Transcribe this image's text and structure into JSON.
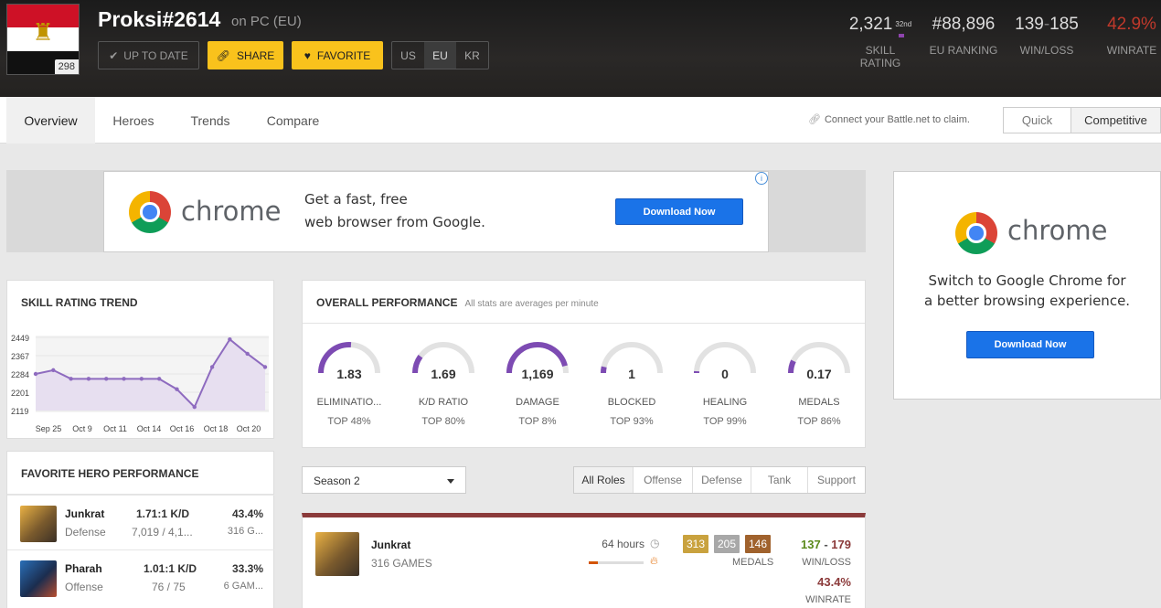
{
  "header": {
    "player_name": "Proksi#2614",
    "platform": "on PC (EU)",
    "level": "298",
    "up_to_date_label": "UP TO DATE",
    "share_label": "SHARE",
    "favorite_label": "FAVORITE",
    "regions": [
      "US",
      "EU",
      "KR"
    ],
    "active_region": "EU",
    "stats": {
      "skill_rating": "2,321",
      "skill_rating_sub": "32nd",
      "skill_rating_label": "SKILL RATING",
      "eu_ranking": "#88,896",
      "eu_ranking_label": "EU RANKING",
      "wins": "139",
      "losses": "185",
      "winloss_label": "WIN/LOSS",
      "winrate": "42.9%",
      "winrate_label": "WINRATE"
    }
  },
  "nav": {
    "tabs": [
      "Overview",
      "Heroes",
      "Trends",
      "Compare"
    ],
    "active_tab": "Overview",
    "claim_text": "Connect your Battle.net to claim.",
    "modes": [
      "Quick",
      "Competitive"
    ],
    "active_mode": "Competitive"
  },
  "ad_main": {
    "brand": "chrome",
    "line1": "Get a fast, free",
    "line2": "web browser from Google.",
    "button": "Download Now"
  },
  "ad_side": {
    "brand": "chrome",
    "line1": "Switch to Google Chrome for",
    "line2": "a better browsing experience.",
    "button": "Download Now"
  },
  "sr_trend": {
    "title": "SKILL RATING TREND",
    "accent": "#8e6bbf",
    "chart_data": {
      "type": "area",
      "title": "SKILL RATING TREND",
      "y_ticks": [
        "2449",
        "2367",
        "2284",
        "2201",
        "2119"
      ],
      "ylim": [
        2119,
        2449
      ],
      "x_labels": [
        "Sep 25",
        "Oct 9",
        "Oct 11",
        "Oct 14",
        "Oct 16",
        "Oct 18",
        "Oct 20"
      ],
      "values": [
        2284,
        2301,
        2262,
        2262,
        2262,
        2262,
        2262,
        2262,
        2215,
        2135,
        2315,
        2440,
        2375,
        2315
      ]
    }
  },
  "performance": {
    "title": "OVERALL PERFORMANCE",
    "subtitle": "All stats are averages per minute",
    "gauge_color": "#7d4bb3",
    "gauge_track": "#e2e2e2",
    "stats": [
      {
        "value": "1.83",
        "label": "ELIMINATIO...",
        "top": "TOP 48%",
        "fill": 0.52
      },
      {
        "value": "1.69",
        "label": "K/D RATIO",
        "top": "TOP 80%",
        "fill": 0.2
      },
      {
        "value": "1,169",
        "label": "DAMAGE",
        "top": "TOP 8%",
        "fill": 0.92
      },
      {
        "value": "1",
        "label": "BLOCKED",
        "top": "TOP 93%",
        "fill": 0.07
      },
      {
        "value": "0",
        "label": "HEALING",
        "top": "TOP 99%",
        "fill": 0.01
      },
      {
        "value": "0.17",
        "label": "MEDALS",
        "top": "TOP 86%",
        "fill": 0.14
      }
    ]
  },
  "favorite": {
    "title": "FAVORITE HERO PERFORMANCE",
    "heroes": [
      {
        "name": "Junkrat",
        "role": "Defense",
        "kd": "1.71:1 K/D",
        "dmg": "7,019 / 4,1...",
        "winrate": "43.4%",
        "games": "316 G..."
      },
      {
        "name": "Pharah",
        "role": "Offense",
        "kd": "1.01:1 K/D",
        "dmg": "76 / 75",
        "winrate": "33.3%",
        "games": "6 GAM..."
      }
    ]
  },
  "filters": {
    "season": "Season 2",
    "roles": [
      "All Roles",
      "Offense",
      "Defense",
      "Tank",
      "Support"
    ],
    "active_role": "All Roles"
  },
  "hero_detail": {
    "name": "Junkrat",
    "games": "316 GAMES",
    "hours": "64 hours",
    "medals": [
      "313",
      "205",
      "146"
    ],
    "medal_colors": [
      "#c9a23e",
      "#a8a8a8",
      "#a0622d"
    ],
    "medals_label": "MEDALS",
    "wins": "137",
    "losses": "179",
    "winloss_label": "WIN/LOSS",
    "winrate": "43.4%",
    "winrate_label": "WINRATE"
  }
}
